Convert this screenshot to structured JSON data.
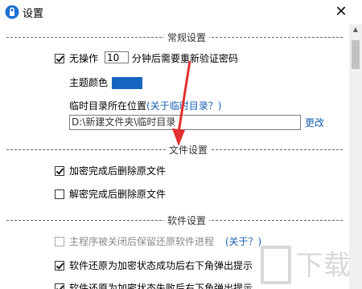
{
  "window": {
    "title": "设置",
    "close_glyph": "✕"
  },
  "sections": {
    "general": "常规设置",
    "file": "文件设置",
    "software": "软件设置"
  },
  "general": {
    "idle_prefix": "无操作",
    "idle_minutes": "10",
    "idle_suffix": "分钟后需要重新验证密码",
    "theme_label": "主题颜色",
    "theme_color": "#1565c0",
    "temp_dir_label": "临时目录所在位置",
    "temp_dir_help": "(关于临时目录？)",
    "temp_dir_value": "D:\\新建文件夹\\临时目录",
    "change_link": "更改"
  },
  "file": {
    "delete_after_encrypt": "加密完成后删除原文件",
    "delete_after_decrypt": "解密完成后删除原文件"
  },
  "software": {
    "keep_restore_process": "主程序被关闭后保留还原软件进程",
    "about_link": "(关于？)",
    "popup_after_restore": "软件还原为加密状态成功后右下角弹出提示",
    "partial_next": "软件还原为加密状态失败后右下角弹出提示"
  },
  "arrow_color": "#e03030"
}
